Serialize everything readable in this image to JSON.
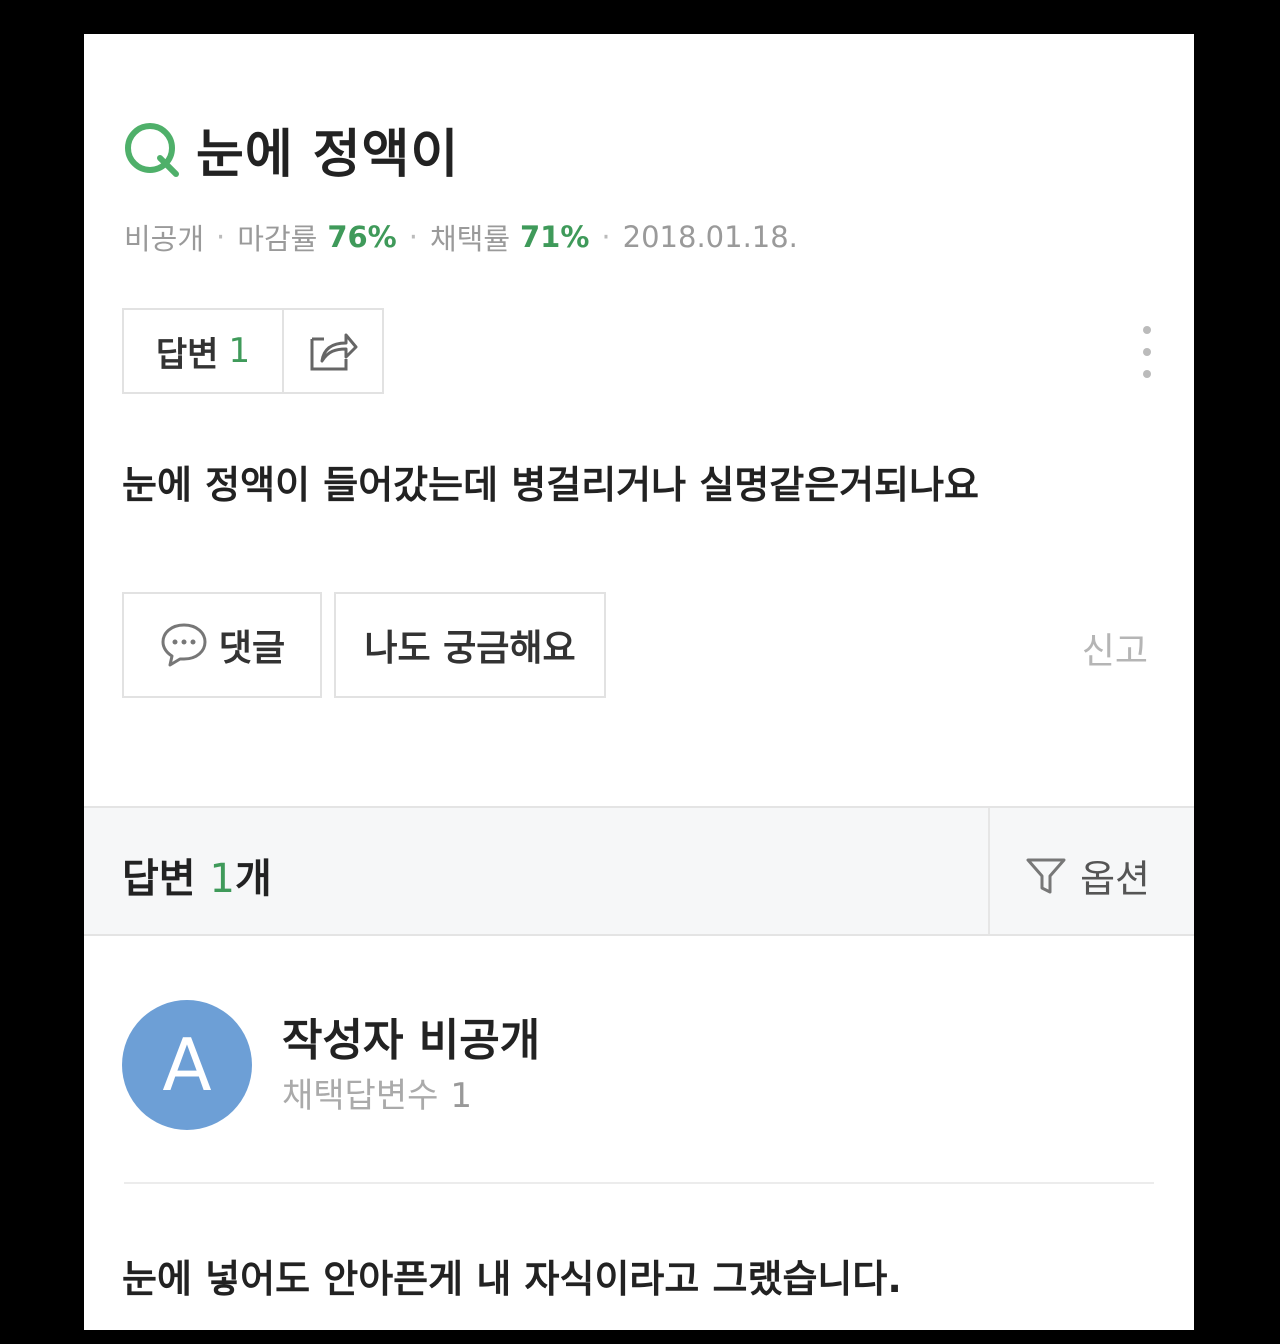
{
  "question": {
    "title": "눈에 정액이",
    "meta": {
      "visibility": "비공개",
      "close_rate_label": "마감률",
      "close_rate_value": "76%",
      "adopt_rate_label": "채택률",
      "adopt_rate_value": "71%",
      "date": "2018.01.18."
    },
    "answer_button_label": "답변",
    "answer_button_count": "1",
    "body": "눈에 정액이 들어갔는데 병걸리거나 실명같은거되나요",
    "comment_label": "댓글",
    "curious_label": "나도 궁금해요",
    "report_label": "신고"
  },
  "answers_header": {
    "title_prefix": "답변 ",
    "count": "1",
    "title_suffix": "개",
    "option_label": "옵션"
  },
  "answer": {
    "avatar_letter": "A",
    "author_name": "작성자 비공개",
    "adopted_label": "채택답변수",
    "adopted_count": "1",
    "body": "눈에 넣어도 안아픈게 내 자식이라고 그랬습니다."
  },
  "colors": {
    "accent_green": "#3f9a5a",
    "avatar_blue": "#6d9fd6"
  },
  "icons": [
    "q-icon",
    "share-icon",
    "more-vertical-icon",
    "comment-bubble-icon",
    "filter-icon"
  ]
}
